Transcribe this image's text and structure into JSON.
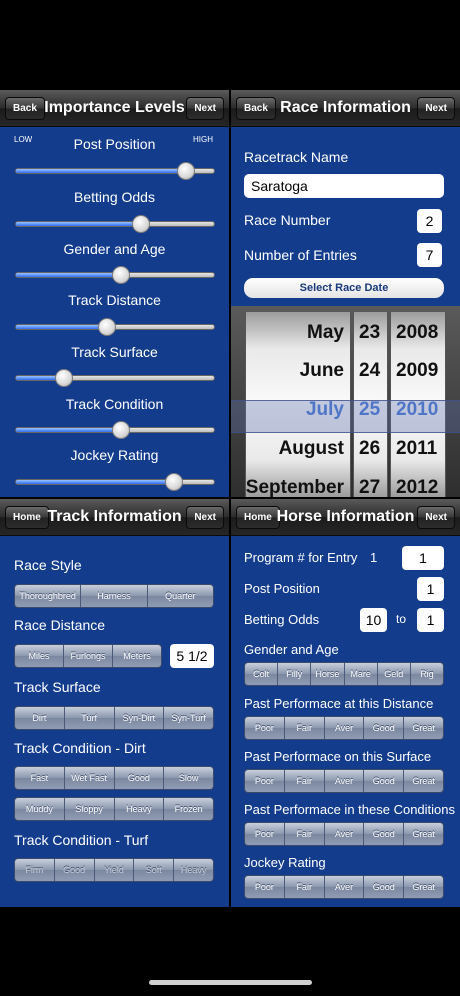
{
  "importance": {
    "back": "Back",
    "title": "Importance Levels",
    "next": "Next",
    "low": "LOW",
    "high": "HIGH",
    "sliders": [
      {
        "label": "Post Position",
        "value": 0.86
      },
      {
        "label": "Betting Odds",
        "value": 0.63
      },
      {
        "label": "Gender and Age",
        "value": 0.53
      },
      {
        "label": "Track Distance",
        "value": 0.46
      },
      {
        "label": "Track Surface",
        "value": 0.24
      },
      {
        "label": "Track Condition",
        "value": 0.53
      },
      {
        "label": "Jockey Rating",
        "value": 0.8
      }
    ]
  },
  "race": {
    "back": "Back",
    "title": "Race Information",
    "next": "Next",
    "racetrack_label": "Racetrack Name",
    "racetrack_value": "Saratoga",
    "race_number_label": "Race Number",
    "race_number": "2",
    "entries_label": "Number of Entries",
    "entries": "7",
    "date_button": "Select Race Date",
    "picker": {
      "months": [
        "May",
        "June",
        "July",
        "August",
        "September"
      ],
      "days": [
        "23",
        "24",
        "25",
        "26",
        "27"
      ],
      "years": [
        "2008",
        "2009",
        "2010",
        "2011",
        "2012"
      ]
    }
  },
  "track": {
    "home": "Home",
    "title": "Track Information",
    "next": "Next",
    "style_label": "Race Style",
    "style_options": [
      "Thoroughbred",
      "Harness",
      "Quarter"
    ],
    "distance_label": "Race Distance",
    "distance_options": [
      "Miles",
      "Furlongs",
      "Meters"
    ],
    "distance_value": "5 1/2",
    "surface_label": "Track Surface",
    "surface_options": [
      "Dirt",
      "Turf",
      "Syn-Dirt",
      "Syn-Turf"
    ],
    "dirt_label": "Track Condition - Dirt",
    "dirt_row1": [
      "Fast",
      "Wet Fast",
      "Good",
      "Slow"
    ],
    "dirt_row2": [
      "Muddy",
      "Sloppy",
      "Heavy",
      "Frozen"
    ],
    "turf_label": "Track Condition - Turf",
    "turf_options": [
      "Firm",
      "Good",
      "Yield",
      "Soft",
      "Heavy"
    ]
  },
  "horse": {
    "home": "Home",
    "title": "Horse Information",
    "next": "Next",
    "program_label": "Program # for Entry",
    "program_entry": "1",
    "program_value": "1",
    "post_label": "Post Position",
    "post_value": "1",
    "odds_label": "Betting Odds",
    "odds_a": "10",
    "odds_to": "to",
    "odds_b": "1",
    "gender_label": "Gender and Age",
    "gender_options": [
      "Colt",
      "Filly",
      "Horse",
      "Mare",
      "Geld",
      "Rig"
    ],
    "distance_label": "Past Performace at this Distance",
    "surface_label": "Past Performace on this Surface",
    "conditions_label": "Past Performace in these Conditions",
    "jockey_label": "Jockey Rating",
    "rating_options": [
      "Poor",
      "Fair",
      "Aver",
      "Good",
      "Great"
    ]
  }
}
